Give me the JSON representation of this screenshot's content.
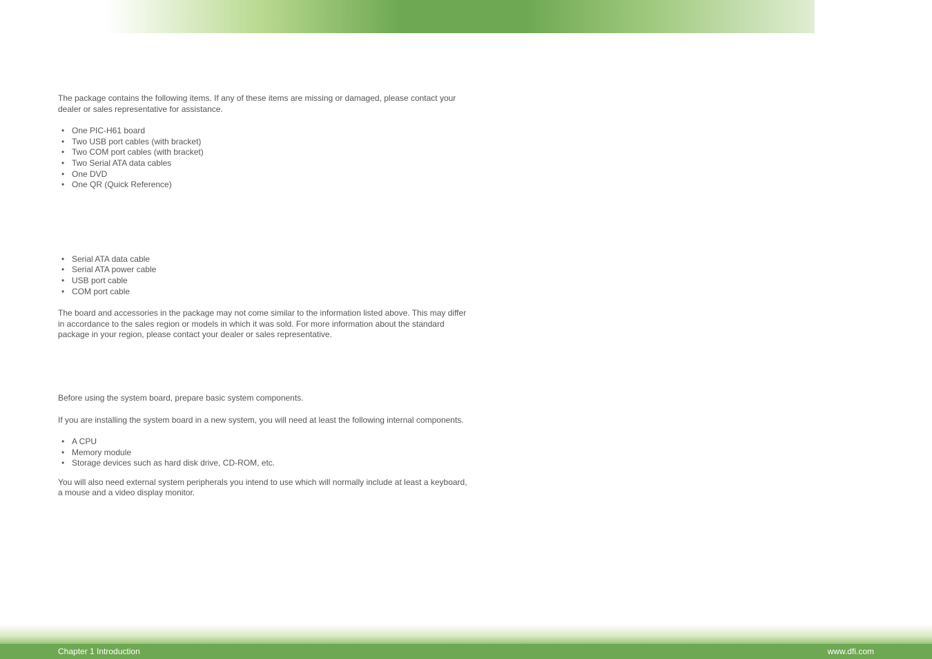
{
  "intro_para": "The package contains the following items. If any of these items are missing or damaged, please contact your dealer or sales representative for assistance.",
  "package_items": [
    "One PIC-H61 board",
    "Two USB port cables (with bracket)",
    "Two COM port cables (with bracket)",
    "Two Serial ATA data cables",
    "One DVD",
    "One QR (Quick Reference)"
  ],
  "optional_items": [
    "Serial ATA data cable",
    "Serial ATA power cable",
    "USB port cable",
    "COM port cable"
  ],
  "optional_note": "The board and accessories in the package may not come similar to the information listed above. This may differ in accordance to the sales region or models in which it was sold. For more information about the standard package in your region, please contact your dealer or sales representative.",
  "before_para1": "Before using the system board, prepare basic system components.",
  "before_para2": "If you are installing the system board in a new system, you will need at least the following internal components.",
  "internal_components": [
    "A CPU",
    "Memory module",
    "Storage devices such as hard disk drive, CD-ROM, etc."
  ],
  "before_para3": "You will also need external system peripherals you intend to use which will normally include at least a keyboard, a mouse and a video display monitor.",
  "footer": {
    "left": "Chapter 1 Introduction",
    "right": "www.dfi.com"
  }
}
